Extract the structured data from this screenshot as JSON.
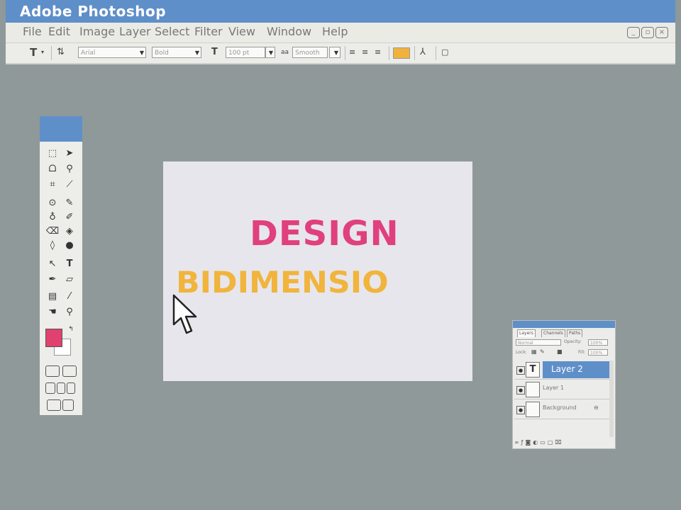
{
  "app": {
    "title": "Adobe Photoshop"
  },
  "menu": [
    "File",
    "Edit",
    "Image",
    "Layer",
    "Select",
    "Filter",
    "View",
    "Window",
    "Help"
  ],
  "window_controls": [
    "minimize",
    "restore",
    "close"
  ],
  "options_bar": {
    "tool_icon": "T",
    "font_family": "Arial",
    "font_style": "Bold",
    "font_size": "100 pt",
    "antialias_label": "aa",
    "antialias": "Smooth",
    "text_color": "#f0b23a"
  },
  "toolbox": {
    "tools": [
      "marquee-icon",
      "move-icon",
      "lasso-icon",
      "magic-wand-icon",
      "crop-icon",
      "slice-icon",
      "healing-icon",
      "brush-icon",
      "stamp-icon",
      "history-brush-icon",
      "eraser-icon",
      "fill-icon",
      "blur-icon",
      "dodge-icon",
      "path-select-icon",
      "type-icon",
      "pen-icon",
      "shape-icon",
      "notes-icon",
      "eyedropper-icon",
      "hand-icon",
      "zoom-icon"
    ],
    "foreground_color": "#e0416e",
    "background_color": "#ffffff"
  },
  "canvas": {
    "line1": "DESIGN",
    "line2": "BIDIMENSIO",
    "line1_color": "#e0407e",
    "line2_color": "#f1b43c"
  },
  "layers_panel": {
    "tabs": [
      "Layers",
      "Channels",
      "Paths"
    ],
    "blend_mode": "Normal",
    "opacity_label": "Opacity:",
    "opacity": "100%",
    "lock_label": "Lock:",
    "fill_label": "Fill:",
    "fill": "100%",
    "layers": [
      {
        "name": "Layer 2",
        "type": "text",
        "active": true
      },
      {
        "name": "Layer 1",
        "type": "raster",
        "active": false
      },
      {
        "name": "Background",
        "type": "raster",
        "active": false
      }
    ]
  },
  "colors": {
    "title_blue": "#5f8fc9",
    "workspace_gray": "#8f9999"
  }
}
